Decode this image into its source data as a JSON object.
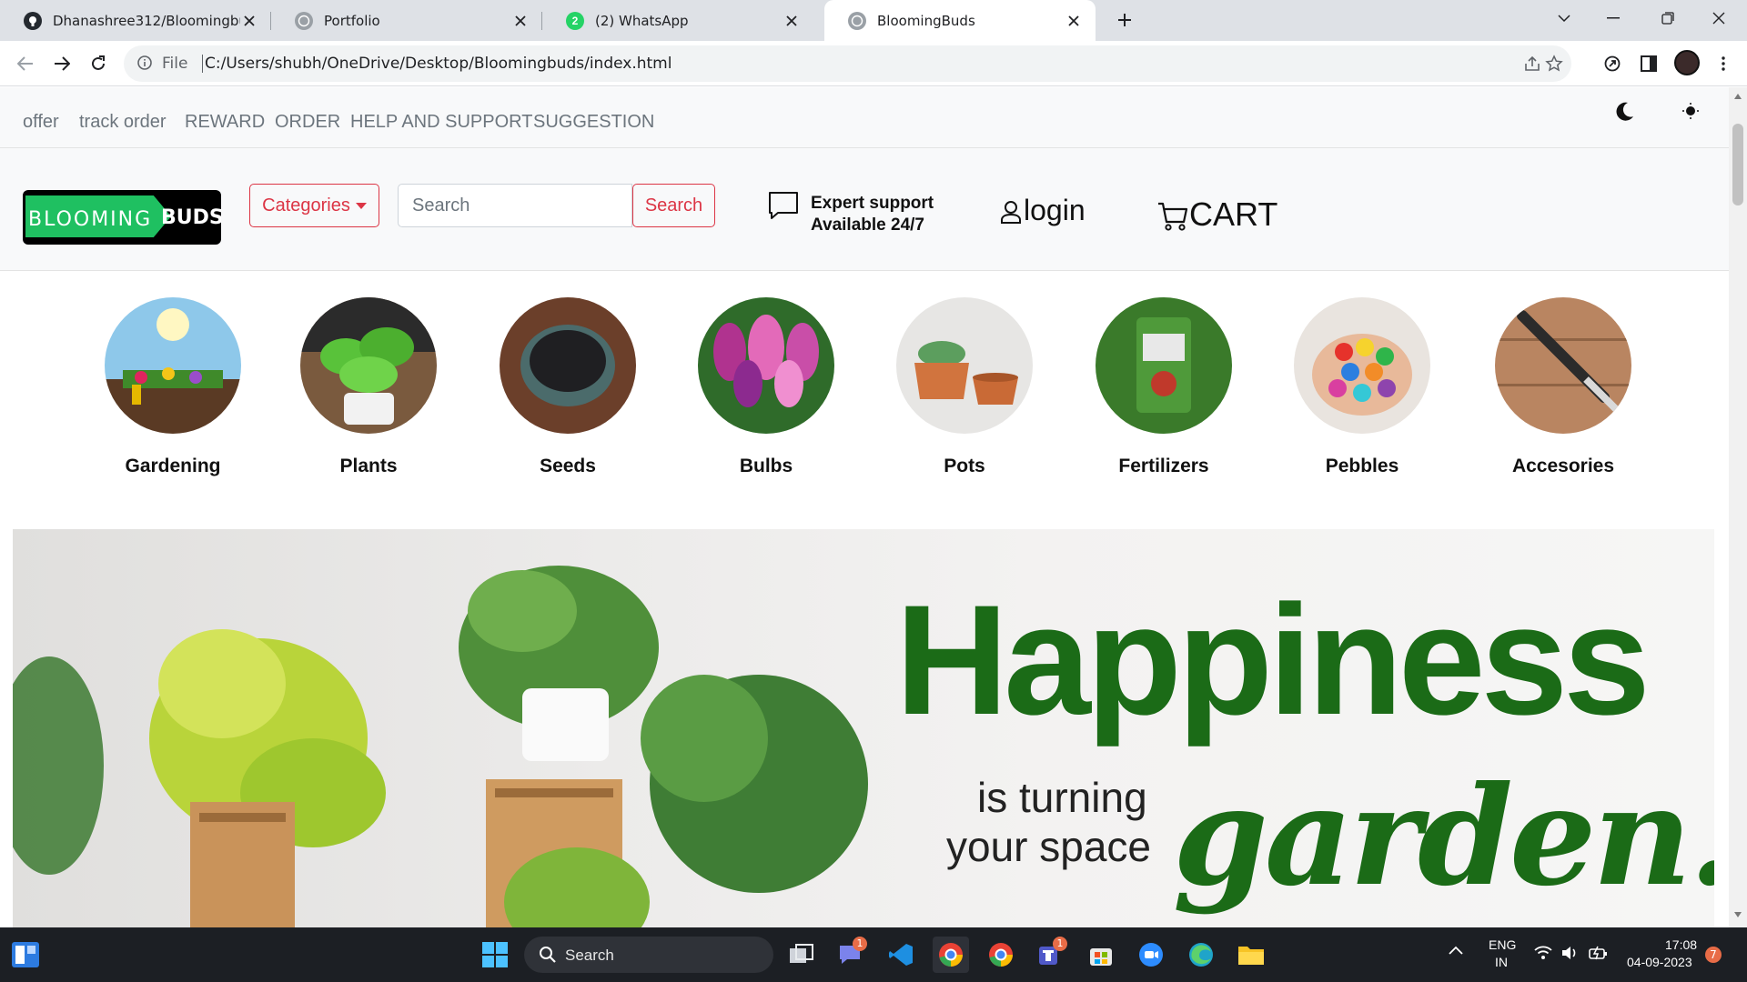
{
  "browser": {
    "tabs": [
      {
        "title": "Dhanashree312/Bloomingbuds",
        "icon": "github-icon",
        "active": false
      },
      {
        "title": "Portfolio",
        "icon": "globe-icon",
        "active": false
      },
      {
        "title": "(2) WhatsApp",
        "icon": "whatsapp-icon",
        "active": false
      },
      {
        "title": "BloomingBuds",
        "icon": "globe-icon",
        "active": true
      }
    ],
    "address": {
      "scheme": "File",
      "url": "C:/Users/shubh/OneDrive/Desktop/Bloomingbuds/index.html"
    }
  },
  "topnav": {
    "links": [
      "offer",
      "track order",
      "REWARD",
      "ORDER",
      "HELP AND SUPPORT",
      "SUGGESTION"
    ]
  },
  "header": {
    "logo": {
      "part1": "BLOOMING",
      "part2": "BUDS"
    },
    "categories_button": "Categories",
    "search_placeholder": "Search",
    "search_button": "Search",
    "support_line1": "Expert support",
    "support_line2": "Available 24/7",
    "login": "login",
    "cart": "CART"
  },
  "categories": [
    {
      "label": "Gardening",
      "icon": "gardening-image"
    },
    {
      "label": "Plants",
      "icon": "plants-image"
    },
    {
      "label": "Seeds",
      "icon": "seeds-image"
    },
    {
      "label": "Bulbs",
      "icon": "bulbs-image"
    },
    {
      "label": "Pots",
      "icon": "pots-image"
    },
    {
      "label": "Fertilizers",
      "icon": "fertilizers-image"
    },
    {
      "label": "Pebbles",
      "icon": "pebbles-image"
    },
    {
      "label": "Accesories",
      "icon": "accessories-image"
    }
  ],
  "banner": {
    "headline": "Happiness",
    "line1": "is turning",
    "line2": "your space",
    "script": "garden..."
  },
  "taskbar": {
    "search_label": "Search",
    "lang1": "ENG",
    "lang2": "IN",
    "time": "17:08",
    "date": "04-09-2023",
    "notifications": "7",
    "teams_badge": "1",
    "teams2_badge": "1"
  },
  "colors": {
    "accent_red": "#dc3545",
    "brand_green": "#1fc061",
    "banner_green": "#1b6b17"
  }
}
